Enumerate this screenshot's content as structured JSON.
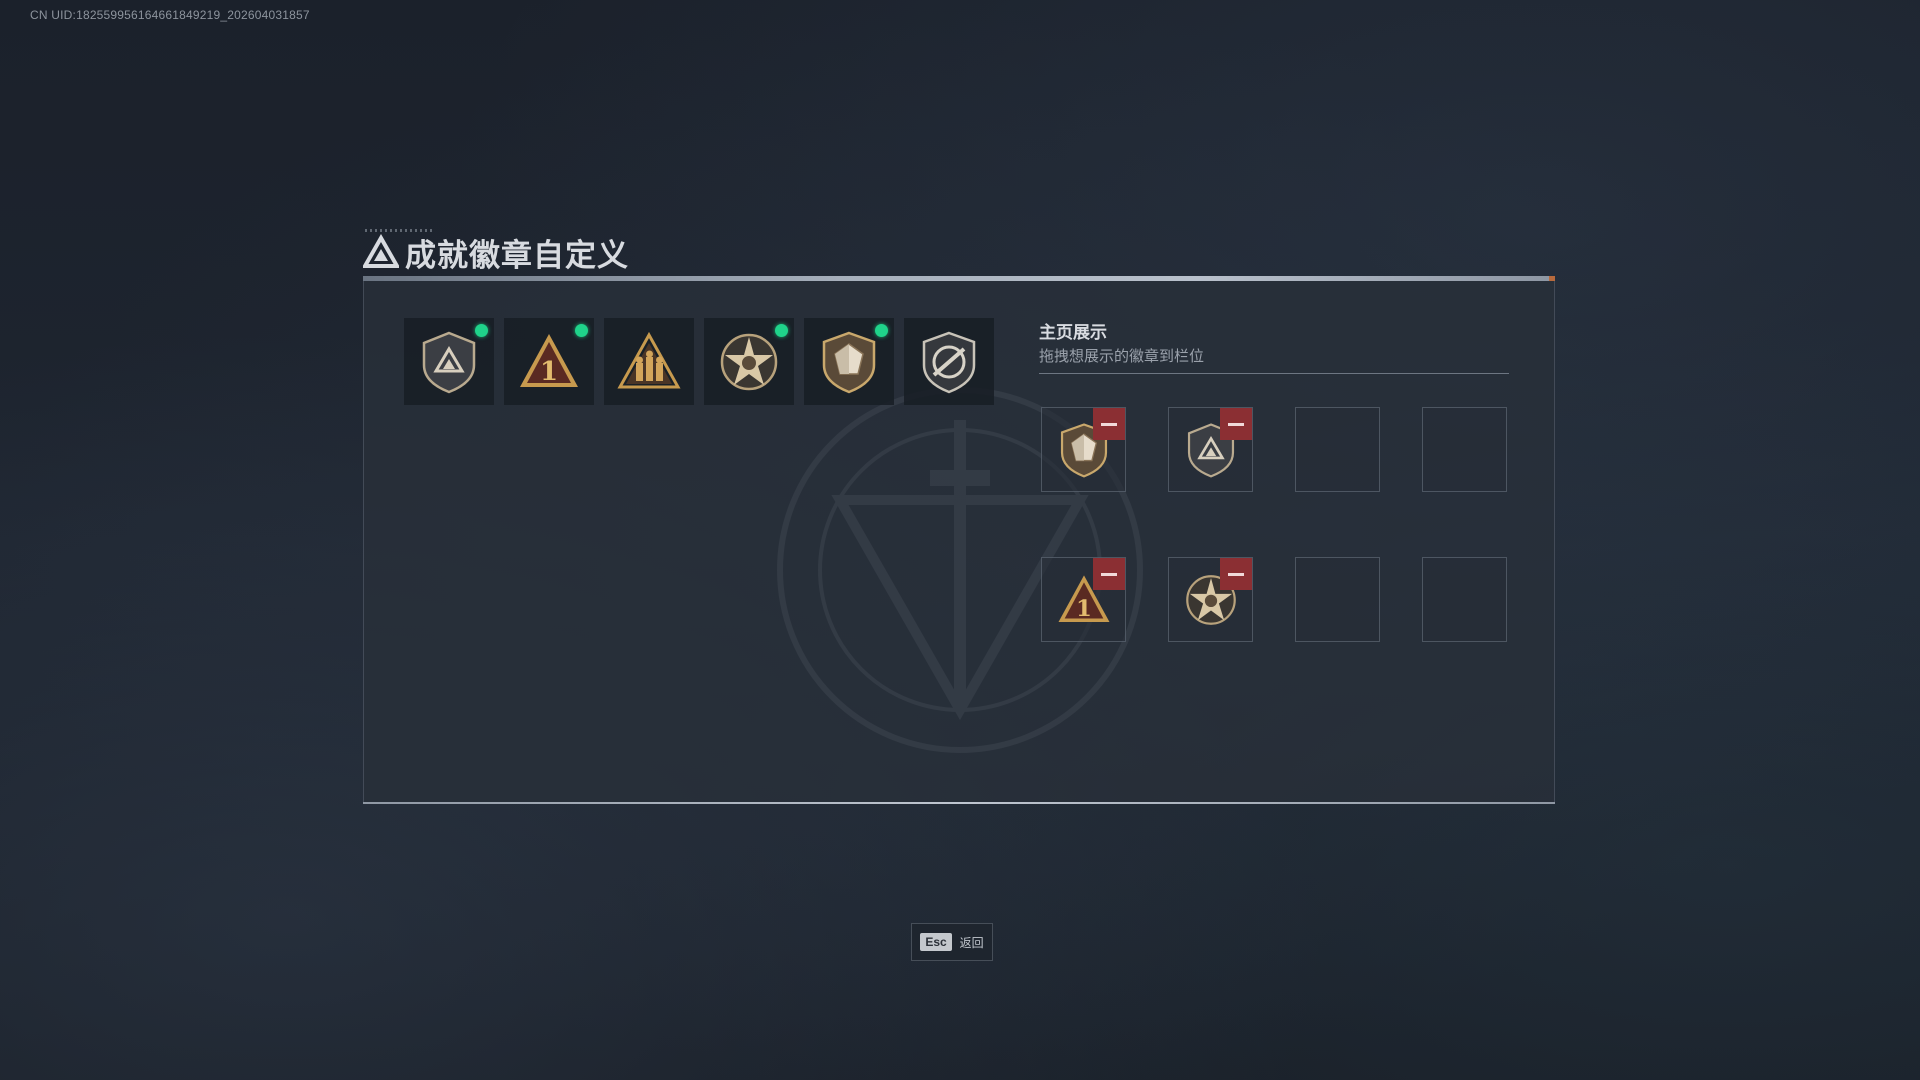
{
  "uid_text": "CN UID:182559956164661849219_202604031857",
  "page": {
    "title": "成就徽章自定义"
  },
  "badges": [
    {
      "icon": "shield-triangle-badge-icon",
      "new": true
    },
    {
      "icon": "number-one-triangle-badge-icon",
      "new": true
    },
    {
      "icon": "warriors-triangle-badge-icon",
      "new": false
    },
    {
      "icon": "star-medal-badge-icon",
      "new": true
    },
    {
      "icon": "crystal-shield-badge-icon",
      "new": true
    },
    {
      "icon": "slashed-shield-badge-icon",
      "new": false
    }
  ],
  "showcase": {
    "title": "主页展示",
    "subtitle": "拖拽想展示的徽章到栏位",
    "slots": [
      {
        "icon": "crystal-shield-badge-icon",
        "filled": true
      },
      {
        "icon": "shield-triangle-badge-icon",
        "filled": true
      },
      {
        "icon": "",
        "filled": false
      },
      {
        "icon": "",
        "filled": false
      },
      {
        "icon": "number-one-triangle-badge-icon",
        "filled": true
      },
      {
        "icon": "star-medal-badge-icon",
        "filled": true
      },
      {
        "icon": "",
        "filled": false
      },
      {
        "icon": "",
        "filled": false
      }
    ]
  },
  "footer": {
    "esc_key": "Esc",
    "esc_label": "返回"
  },
  "colors": {
    "accent_gold": "#c79a4e",
    "new_dot": "#1fd38a",
    "remove_red": "#8b2f33"
  }
}
